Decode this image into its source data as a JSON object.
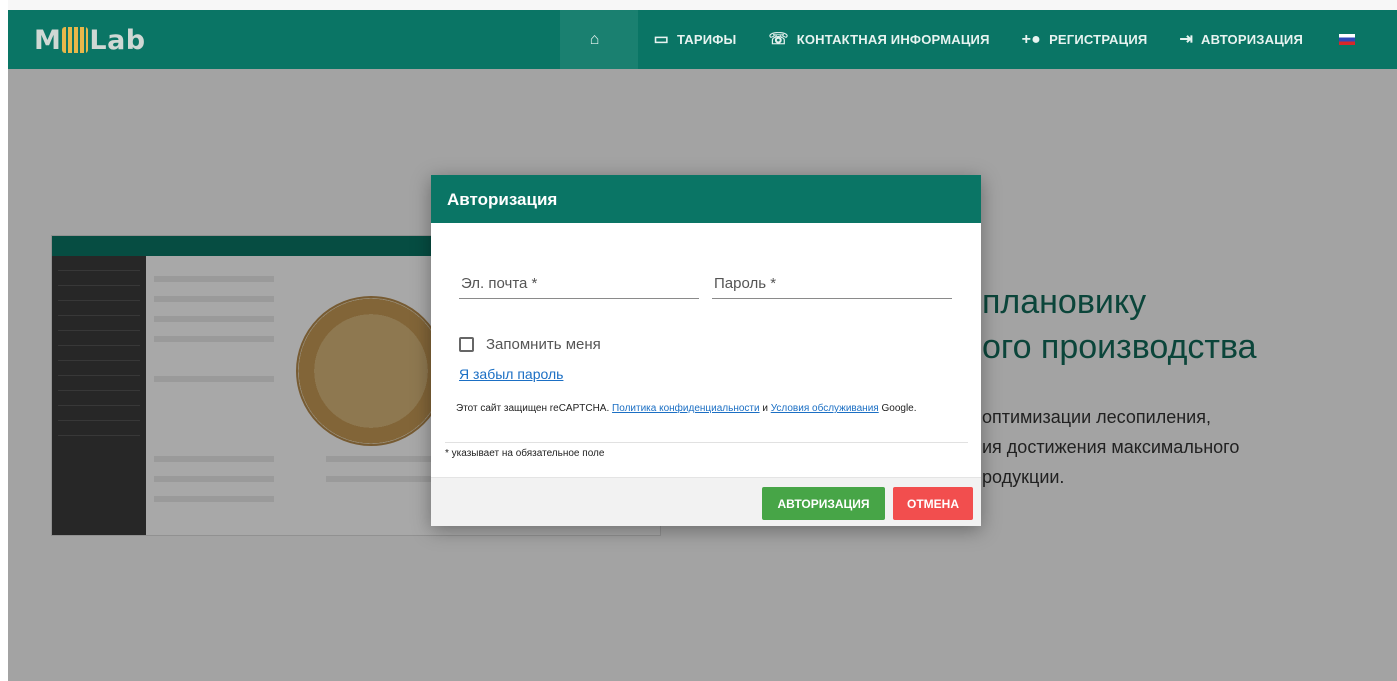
{
  "brand": {
    "logo_text_left": "M",
    "logo_text_right": "Lab"
  },
  "nav": {
    "home_icon": "home-icon",
    "items": [
      {
        "label": "ТАРИФЫ",
        "icon": "card-icon"
      },
      {
        "label": "КОНТАКТНАЯ ИНФОРМАЦИЯ",
        "icon": "phone-icon"
      },
      {
        "label": "РЕГИСТРАЦИЯ",
        "icon": "add-user-icon"
      },
      {
        "label": "АВТОРИЗАЦИЯ",
        "icon": "login-icon"
      }
    ],
    "language_flag": "ru-flag-icon"
  },
  "hero": {
    "title_line1": "плановику",
    "title_line2": "ого производства",
    "desc_line1": "оптимизации лесопиления,",
    "desc_line2": "ия достижения максимального",
    "desc_line3": "родукции."
  },
  "modal": {
    "title": "Авторизация",
    "email_label": "Эл. почта *",
    "password_label": "Пароль *",
    "remember_label": "Запомнить меня",
    "forgot_link": "Я забыл пароль",
    "captcha_text_1": "Этот сайт защищен reCAPTCHA.",
    "captcha_link_privacy": "Политика конфиденциальности",
    "captcha_text_and": "и",
    "captcha_link_terms": "Условия обслуживания",
    "captcha_text_2": "Google.",
    "required_note": "* указывает на обязательное поле",
    "login_button": "АВТОРИЗАЦИЯ",
    "cancel_button": "ОТМЕНА"
  },
  "colors": {
    "primary": "#0a7565",
    "login_button": "#47a547",
    "cancel_button": "#f24e4e",
    "link": "#1b6fc4"
  }
}
